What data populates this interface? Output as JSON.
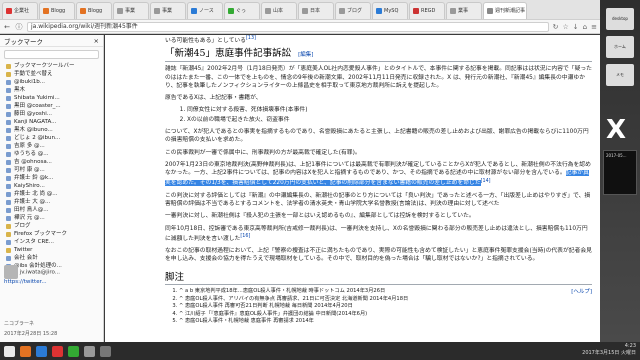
{
  "browser": {
    "tabs": [
      {
        "label": "企業社",
        "color": "#d33"
      },
      {
        "label": "Blogg",
        "color": "#e37222"
      },
      {
        "label": "Blogg",
        "color": "#e37222"
      },
      {
        "label": "事業",
        "color": "#999"
      },
      {
        "label": "事業",
        "color": "#999"
      },
      {
        "label": "ノース",
        "color": "#2b7bd6"
      },
      {
        "label": "ぐっ",
        "color": "#3a3"
      },
      {
        "label": "山本",
        "color": "#999"
      },
      {
        "label": "日本",
        "color": "#999"
      },
      {
        "label": "ブログ",
        "color": "#999"
      },
      {
        "label": "MySQ",
        "color": "#2b7bd6"
      },
      {
        "label": "REGD",
        "color": "#c33"
      },
      {
        "label": "業事",
        "color": "#999"
      }
    ],
    "active_tab": {
      "label": "週刊新潮記事",
      "close": "×"
    },
    "url": "ja.wikipedia.org/wiki/週刊新潮45事件"
  },
  "sidebar": {
    "title": "ブックマーク",
    "close": "×",
    "items": [
      {
        "label": "ブックマークツールバー",
        "folder": true
      },
      {
        "label": "手動で並べ替え",
        "folder": true
      },
      {
        "label": "@ibuki1b...",
        "folder": false
      },
      {
        "label": "黒木",
        "folder": false
      },
      {
        "label": "Shibata Yukimi...",
        "folder": false
      },
      {
        "label": "黒田 @coaster_...",
        "folder": false
      },
      {
        "label": "藤田 @yoshi...",
        "folder": false
      },
      {
        "label": "Kanji NAGATA...",
        "folder": false
      },
      {
        "label": "黒木 @ibuno...",
        "folder": false
      },
      {
        "label": "どじょ 2 @ibun...",
        "folder": false
      },
      {
        "label": "吉原 多 @...",
        "folder": false
      },
      {
        "label": "ゆうちる @...",
        "folder": false
      },
      {
        "label": "吉 @ohnosa...",
        "folder": false
      },
      {
        "label": "可村 康 @...",
        "folder": false
      },
      {
        "label": "弁護士 鈴 @k...",
        "folder": false
      },
      {
        "label": "KaiyShiro...",
        "folder": false
      },
      {
        "label": "弁護士 北 尚 @...",
        "folder": false
      },
      {
        "label": "弁護士 大 @...",
        "folder": false
      },
      {
        "label": "田村 鳥人@...",
        "folder": false
      },
      {
        "label": "樺沢 元 @...",
        "folder": false
      },
      {
        "label": "ブログ",
        "folder": true
      },
      {
        "label": "Firefox ブックマーク",
        "folder": true
      },
      {
        "label": "インスタ CRE...",
        "folder": false
      },
      {
        "label": "Twitter",
        "folder": true
      },
      {
        "label": "会社 会計",
        "folder": false
      },
      {
        "label": "@ibs 会計処理の...",
        "folder": false
      }
    ],
    "user_name": "jv.iwata@jiro...",
    "user_link": "https://twitter...",
    "footer_label": "ニコブラーネ",
    "timestamp": "2017年2月28日 15:28"
  },
  "article": {
    "prev_line": "いる可能性もある」としている",
    "prev_ref": "[13]",
    "section_title": "「新潮45」恵庭事件記事訴訟",
    "edit_label": "[編集]",
    "para1": "雑誌『新潮45』2002年2月号（1月18日発売）が「恵庭美人OL社内恋愛殺人事件」とのタイトルで、本事件に関する記事を掲載。同記事はは状況に内容で「疑ったのははたまた一番、この一体でを上ものを、情念の9年後の新潮文庫、2002年11月11日発売に収録された。X は、発行元の新潮社、『新潮45』編集長の中瀬ゆかり、記事を執筆したノンフィクションライターの上條昌史を相手取って東京地方裁判所に訴えを提起した。",
    "para2": "原告であるXは、上記記事・書籍が、",
    "list": [
      "同僚女性に対する殺害、死体損壊事件(本事件)",
      "Xの以前の職場で起きた放火、窃盗事件"
    ],
    "para3": "について、Xが犯人であるとの事実を指摘するものであり、名誉毀損にあたると主張し、上記書籍の販売の差し止めおよび出版、謝罪広告の掲載ならびに1100万円の損害賠償の支払いを求めた。",
    "para4": "この民事裁判が一審で係属中に、刑事裁判の方が最高裁で確定した(有罪)。",
    "para5": "2007年1月23日の東京地裁判決(高野伸裁判長)は、上記1事件については最高裁で有罪判決が確定していることからXが犯人であるとし、新潮社側の不法行為を認めなかった。一方、上記2事件については、記事の内容はXを犯人と指摘するものであり、かつ、その指摘である記述の中に取材源がない部分を含んでいる。",
    "para5_hl": "記事が真実を認めた。その1/3を、損害賠償として220万円の支払いと、記事の削除部分を含まない書籍の販売の差し止めを命じた",
    "para5_ref": "[14]",
    "para6": "この判決に対する評価としては『新潮』の中瀬編集長の、新潮社の記事のとり方については「良い判決」であったと述べる一方、",
    "para6b": "「出版差し止めはやりすぎ」で、損害賠償の評価は不当であるとするコメントを、法学者の清水英夫・青山学院大学名誉教授(言論法)は、判決の理由に対して述べた",
    "para7": "一審判決に対し、新潮社側は『殺人犯の主張を一部とはいえ認めるもの』、編集部としては控訴を検討するとしていた。",
    "para8": "同年10月18日、控訴審である東京高等裁判所(吉戒修一裁判長)は、一審判決を支持し、Xの名誉毀損に関わる部分の販売差し止めは違法とし、損害賠償も110万円に減額した判決を言い渡した",
    "para8_ref": "[16]",
    "para9": "なおこの記事の取材過程において、上記「警察の捜査は不正に満ちたものであり、実際の可能性も含めて検証したい」と恵庭事件冤罪支援会(当時)の代表が記者会見を申し込み、支援会の協力を得たうえで現場取材をしている。その中で、取材目的を偽った場合は「騙し取材ではないか?」と指摘されている。",
    "notes_title": "脚注",
    "notes_help": "[ヘルプ]",
    "refs": [
      "^ a b 東京地判平成18年…恵庭OL殺人事件・札幌地裁 時事ドットコム 2014年3月26日",
      "^ 恵庭OL殺人事件、アリバイの有無争点 再審請求、21日に可否決定 北海道新聞 2014年4月18日",
      "^ 恵庭OL殺人事件 再審可否21日判断 札幌地裁 毎日新聞 2014年4月20日",
      "^ 江川紹子「『恵庭事件』恵庭OL殺人事件」弁護団の結論 中日新聞(2014年6月)",
      "^ 恵庭OL殺人事件・札幌地裁 恵庭事件 再審請求 2014年"
    ]
  },
  "desktop": {
    "icons": [
      "desktop",
      "ホーム",
      "2017-05...",
      "メモ"
    ],
    "logo_text": "X",
    "thumb_label": "2017-05..."
  },
  "taskbar": {
    "clock_time": "4:23",
    "clock_date": "2017年3月15日 火曜日",
    "icon_colors": [
      "#e9e9e9",
      "#e37222",
      "#2b7bd6",
      "#d33",
      "#3a3",
      "#999",
      "#777"
    ]
  }
}
